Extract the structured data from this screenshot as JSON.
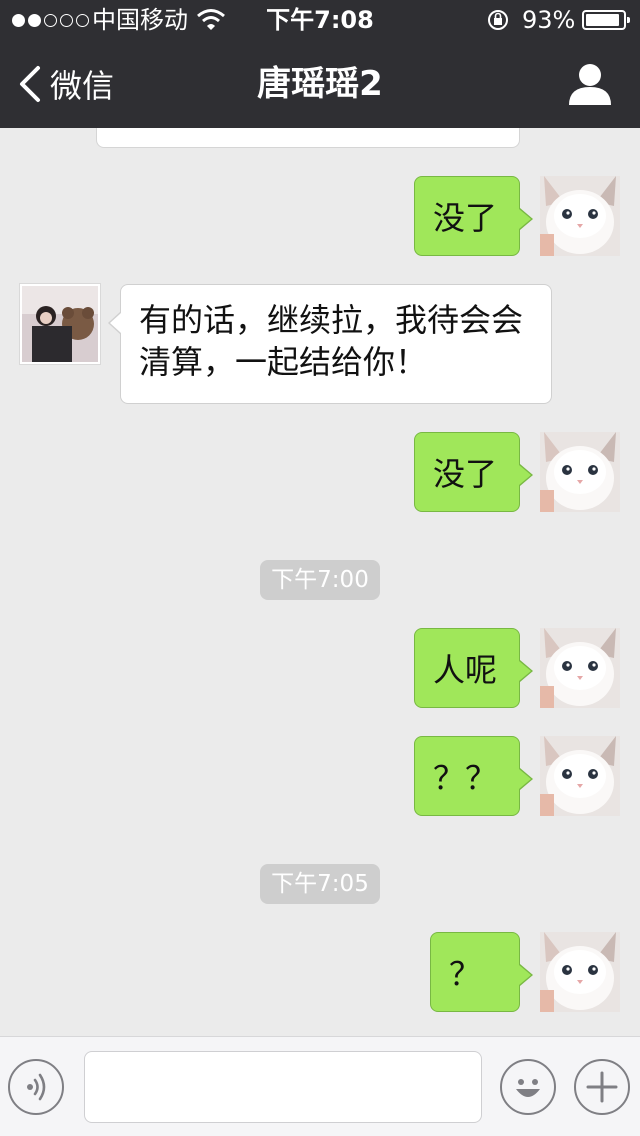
{
  "status_bar": {
    "carrier": "中国移动",
    "time": "下午7:08",
    "battery": "93%",
    "battery_level": 0.93,
    "signal_bars": 2,
    "signal_total": 5
  },
  "nav": {
    "back_label": "微信",
    "title": "唐瑶瑶2",
    "back_icon": "chevron-left-icon",
    "profile_icon": "person-icon"
  },
  "messages": [
    {
      "from": "me",
      "text": "没了"
    },
    {
      "from": "them",
      "text": "有的话，继续拉，我待会会清算，一起结给你！"
    },
    {
      "from": "me",
      "text": "没了"
    },
    {
      "from": "me",
      "text": "人呢"
    },
    {
      "from": "me",
      "text": "？？"
    },
    {
      "from": "me",
      "text": "？"
    }
  ],
  "timestamps": [
    "下午7:00",
    "下午7:05"
  ],
  "input": {
    "placeholder": "",
    "voice_icon": "voice-icon",
    "emoji_icon": "emoji-icon",
    "plus_icon": "plus-icon"
  },
  "colors": {
    "header": "#2f2f33",
    "chat_bg": "#ebebeb",
    "my_bubble": "#a0e75a",
    "their_bubble": "#ffffff"
  }
}
